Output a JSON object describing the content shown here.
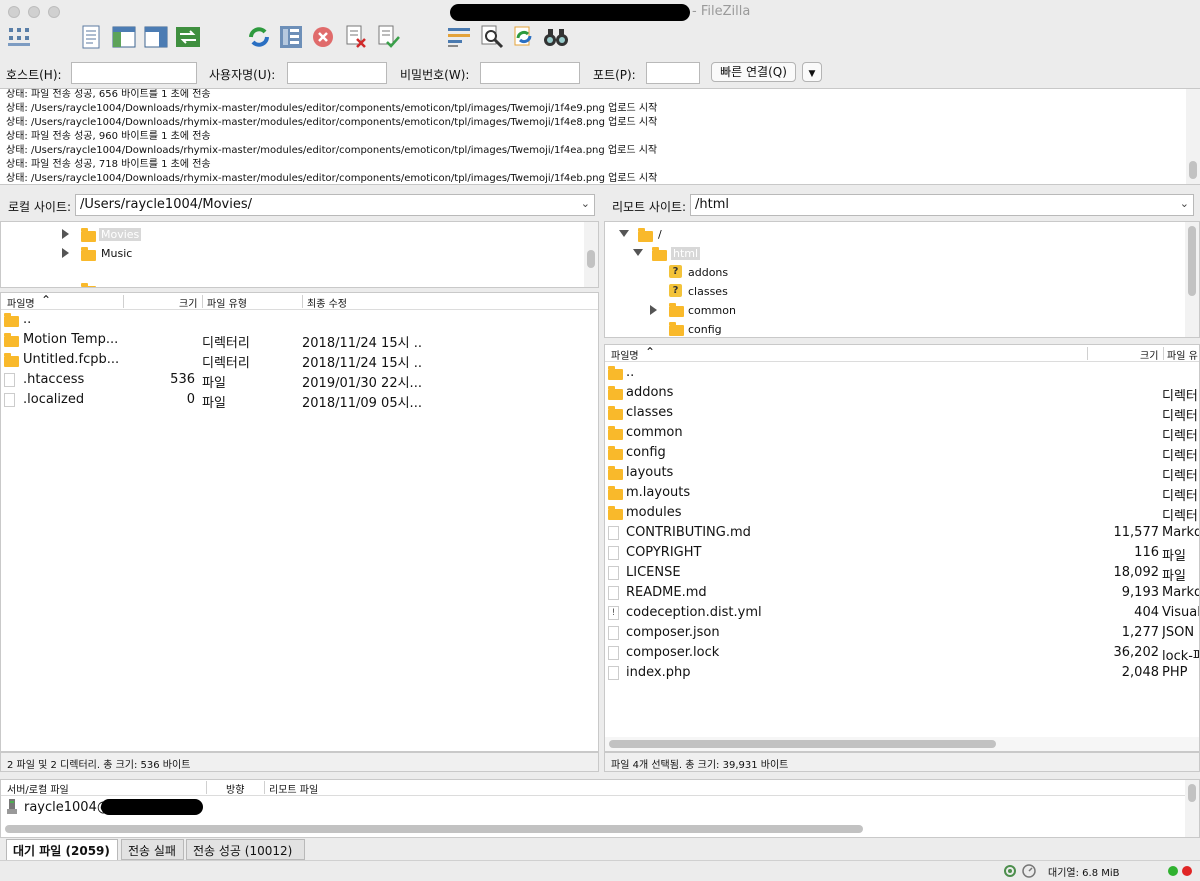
{
  "window": {
    "title_suffix": "- FileZilla"
  },
  "toolbar": {
    "icons": [
      "site-manager-icon",
      "toggle-log-icon",
      "toggle-local-tree-icon",
      "toggle-remote-tree-icon",
      "transfer-queue-icon",
      "refresh-icon",
      "process-queue-icon",
      "cancel-icon",
      "disconnect-icon",
      "reconnect-icon",
      "directory-filter-icon",
      "search-icon",
      "synchronized-browsing-icon",
      "compare-icon"
    ]
  },
  "quickconnect": {
    "host_label": "호스트(H):",
    "user_label": "사용자명(U):",
    "pass_label": "비밀번호(W):",
    "port_label": "포트(P):",
    "connect_label": "빠른 연결(Q)",
    "host_value": "",
    "user_value": "",
    "pass_value": "",
    "port_value": ""
  },
  "log": {
    "lines": [
      "상태:  파일 전송 성공, 656 바이트를 1 초에 전송",
      "상태:  /Users/raycle1004/Downloads/rhymix-master/modules/editor/components/emoticon/tpl/images/Twemoji/1f4e9.png 업로드 시작",
      "상태:  /Users/raycle1004/Downloads/rhymix-master/modules/editor/components/emoticon/tpl/images/Twemoji/1f4e8.png 업로드 시작",
      "상태:  파일 전송 성공, 960 바이트를 1 초에 전송",
      "상태:  /Users/raycle1004/Downloads/rhymix-master/modules/editor/components/emoticon/tpl/images/Twemoji/1f4ea.png 업로드 시작",
      "상태:  파일 전송 성공, 718 바이트를 1 초에 전송",
      "상태:  /Users/raycle1004/Downloads/rhymix-master/modules/editor/components/emoticon/tpl/images/Twemoji/1f4eb.png 업로드 시작"
    ]
  },
  "local": {
    "site_label": "로컬 사이트:",
    "path": "/Users/raycle1004/Movies/",
    "tree": [
      {
        "label": "Movies",
        "selected": true
      },
      {
        "label": "Music",
        "selected": false
      }
    ],
    "headers": {
      "name": "파일명",
      "size": "크기",
      "type": "파일 유형",
      "modified": "최종 수정"
    },
    "files": [
      {
        "name": "..",
        "size": "",
        "type": "",
        "modified": "",
        "kind": "folder"
      },
      {
        "name": "Motion Temp...",
        "size": "",
        "type": "디렉터리",
        "modified": "2018/11/24 15시 ...",
        "kind": "folder"
      },
      {
        "name": "Untitled.fcpb...",
        "size": "",
        "type": "디렉터리",
        "modified": "2018/11/24 15시 ...",
        "kind": "folder"
      },
      {
        "name": ".htaccess",
        "size": "536",
        "type": "파일",
        "modified": "2019/01/30 22시...",
        "kind": "file"
      },
      {
        "name": ".localized",
        "size": "0",
        "type": "파일",
        "modified": "2018/11/09 05시...",
        "kind": "file"
      }
    ],
    "status": "2 파일 및 2 디렉터리. 총 크기: 536 바이트"
  },
  "remote": {
    "site_label": "리모트 사이트:",
    "path": "/html",
    "tree": [
      {
        "label": "/",
        "kind": "folder"
      },
      {
        "label": "html",
        "kind": "folder"
      },
      {
        "label": "addons",
        "kind": "unknown"
      },
      {
        "label": "classes",
        "kind": "unknown"
      },
      {
        "label": "common",
        "kind": "folder"
      },
      {
        "label": "config",
        "kind": "folder"
      }
    ],
    "headers": {
      "name": "파일명",
      "size": "크기",
      "type": "파일 유"
    },
    "files": [
      {
        "name": "..",
        "size": "",
        "type": "",
        "kind": "folder"
      },
      {
        "name": "addons",
        "size": "",
        "type": "디렉터i",
        "kind": "folder"
      },
      {
        "name": "classes",
        "size": "",
        "type": "디렉터i",
        "kind": "folder"
      },
      {
        "name": "common",
        "size": "",
        "type": "디렉터i",
        "kind": "folder"
      },
      {
        "name": "config",
        "size": "",
        "type": "디렉터i",
        "kind": "folder"
      },
      {
        "name": "layouts",
        "size": "",
        "type": "디렉터i",
        "kind": "folder"
      },
      {
        "name": "m.layouts",
        "size": "",
        "type": "디렉터i",
        "kind": "folder"
      },
      {
        "name": "modules",
        "size": "",
        "type": "디렉터i",
        "kind": "folder"
      },
      {
        "name": "CONTRIBUTING.md",
        "size": "11,577",
        "type": "Markd",
        "kind": "file"
      },
      {
        "name": "COPYRIGHT",
        "size": "116",
        "type": "파일",
        "kind": "file"
      },
      {
        "name": "LICENSE",
        "size": "18,092",
        "type": "파일",
        "kind": "file"
      },
      {
        "name": "README.md",
        "size": "9,193",
        "type": "Markd",
        "kind": "file"
      },
      {
        "name": "codeception.dist.yml",
        "size": "404",
        "type": "Visual",
        "kind": "yml"
      },
      {
        "name": "composer.json",
        "size": "1,277",
        "type": "JSON",
        "kind": "file"
      },
      {
        "name": "composer.lock",
        "size": "36,202",
        "type": "lock-파",
        "kind": "file"
      },
      {
        "name": "index.php",
        "size": "2,048",
        "type": "PHP",
        "kind": "file"
      }
    ],
    "status": "파일 4개 선택됨. 총 크기: 39,931 바이트"
  },
  "queue": {
    "headers": {
      "server": "서버/로컬 파일",
      "direction": "방향",
      "remote": "리모트 파일"
    },
    "server_entry": "raycle1004@"
  },
  "tabs": [
    {
      "label": "대기 파일 (2059)",
      "active": true
    },
    {
      "label": "전송 실패",
      "active": false
    },
    {
      "label": "전송 성공 (10012)",
      "active": false
    }
  ],
  "statusbar": {
    "queue_label": "대기열: 6.8 MiB"
  }
}
